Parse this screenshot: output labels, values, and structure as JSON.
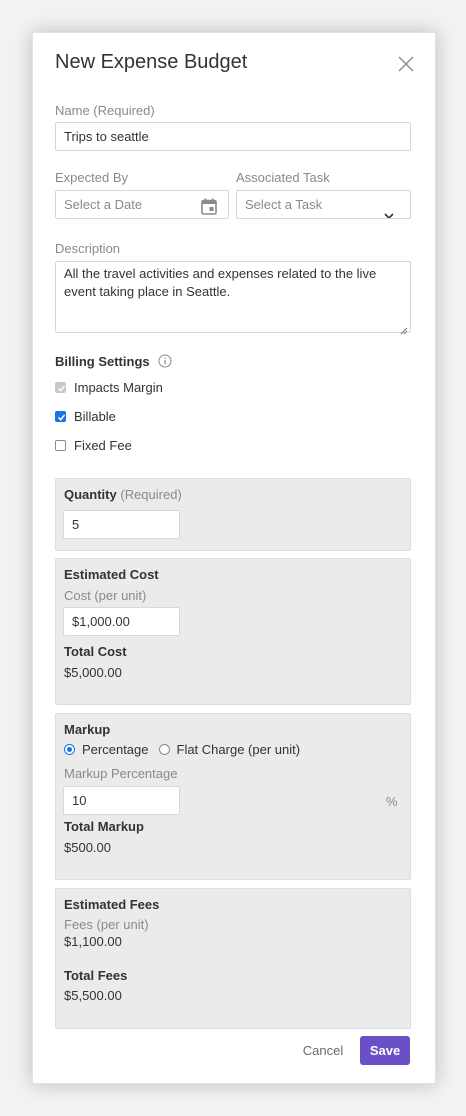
{
  "dialog": {
    "title": "New Expense Budget"
  },
  "form": {
    "name_label": "Name (Required)",
    "name_value": "Trips to seattle",
    "expected_by_label": "Expected By",
    "expected_by_placeholder": "Select a Date",
    "associated_task_label": "Associated Task",
    "associated_task_placeholder": "Select a Task",
    "description_label": "Description",
    "description_value": "All the travel activities and expenses related to the live event taking place in Seattle."
  },
  "billing": {
    "title": "Billing Settings",
    "options": [
      {
        "label": "Impacts Margin",
        "checked": true,
        "disabled": true
      },
      {
        "label": "Billable",
        "checked": true,
        "disabled": false
      },
      {
        "label": "Fixed Fee",
        "checked": false,
        "disabled": false
      }
    ]
  },
  "quantity": {
    "label": "Quantity",
    "required": "(Required)",
    "value": "5"
  },
  "estimated_cost": {
    "title": "Estimated Cost",
    "cost_label": "Cost (per unit)",
    "cost_value": "$1,000.00",
    "total_label": "Total Cost",
    "total_value": "$5,000.00"
  },
  "markup": {
    "title": "Markup",
    "options": [
      {
        "label": "Percentage",
        "selected": true
      },
      {
        "label": "Flat Charge (per unit)",
        "selected": false
      }
    ],
    "percentage_label": "Markup Percentage",
    "percentage_value": "10",
    "unit": "%",
    "total_label": "Total Markup",
    "total_value": "$500.00"
  },
  "estimated_fees": {
    "title": "Estimated Fees",
    "fees_label": "Fees (per unit)",
    "fees_value": "$1,100.00",
    "total_label": "Total Fees",
    "total_value": "$5,500.00"
  },
  "actions": {
    "cancel": "Cancel",
    "save": "Save"
  },
  "colors": {
    "accent": "#6a4fc6",
    "checkbox": "#1a73e8",
    "panel_bg": "#ebebeb"
  }
}
